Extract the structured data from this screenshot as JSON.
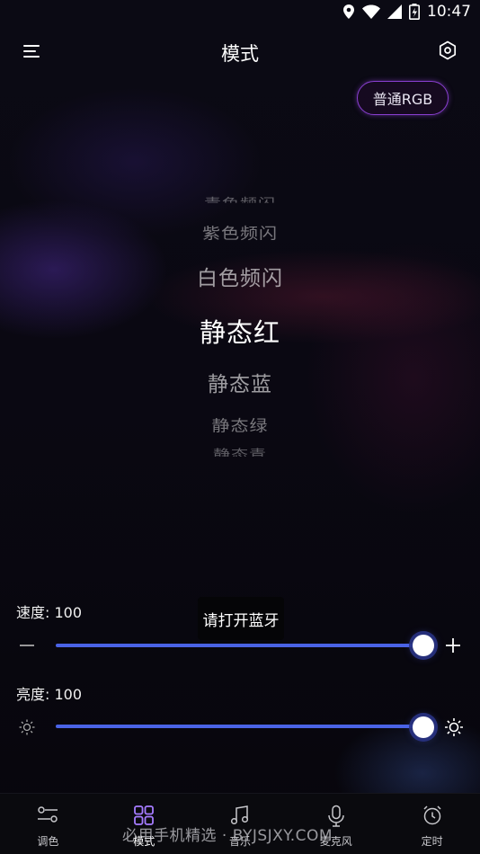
{
  "status_bar": {
    "time": "10:47"
  },
  "header": {
    "title": "模式",
    "mode_chip": "普通RGB"
  },
  "picker": {
    "items": [
      "青色频闪",
      "紫色频闪",
      "白色频闪",
      "静态红",
      "静态蓝",
      "静态绿",
      "静态青"
    ],
    "selected": "静态红"
  },
  "speed": {
    "label": "速度: 100",
    "value": 100,
    "max": 100
  },
  "brightness": {
    "label": "亮度: 100",
    "value": 100,
    "max": 100
  },
  "toast": "请打开蓝牙",
  "nav": {
    "items": [
      {
        "label": "调色",
        "icon": "sliders-icon"
      },
      {
        "label": "模式",
        "icon": "grid-icon"
      },
      {
        "label": "音乐",
        "icon": "music-note-icon"
      },
      {
        "label": "麦克风",
        "icon": "microphone-icon"
      },
      {
        "label": "定时",
        "icon": "alarm-clock-icon"
      }
    ],
    "active_index": 1
  },
  "watermark": "必用手机精选 · BYJSJXY.COM",
  "colors": {
    "accent": "#4a63e6",
    "chip_border": "#8a3fd1",
    "nav_active": "#9b6cff"
  }
}
